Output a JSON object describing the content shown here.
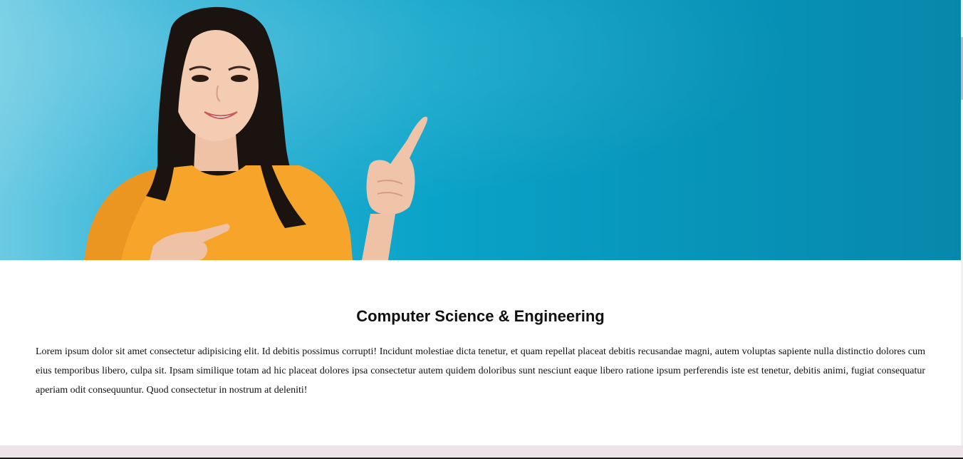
{
  "hero": {
    "image_description": "person-pointing-photo"
  },
  "section": {
    "title": "Computer Science & Engineering",
    "body": "Lorem ipsum dolor sit amet consectetur adipisicing elit. Id debitis possimus corrupti! Incidunt molestiae dicta tenetur, et quam repellat placeat debitis recusandae magni, autem voluptas sapiente nulla distinctio dolores cum eius temporibus libero, culpa sit. Ipsam similique totam ad hic placeat dolores ipsa consectetur autem quidem doloribus sunt nesciunt eaque libero ratione ipsum perferendis iste est tenetur, debitis animi, fugiat consequatur aperiam odit consequuntur. Quod consectetur in nostrum at deleniti!"
  },
  "colors": {
    "hero_background": "#0aa3c8",
    "shirt": "#f7a42a",
    "footer_band": "#efe3ea"
  }
}
